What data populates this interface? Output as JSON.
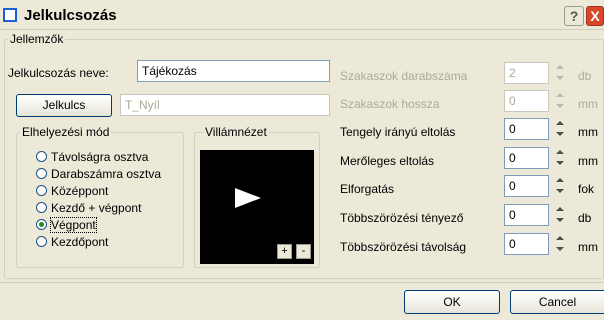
{
  "window": {
    "title": "Jelkulcsozás",
    "help_label": "?",
    "close_label": "X"
  },
  "jellemzok": {
    "label": "Jellemzők",
    "name_label": "Jelkulcsozás neve:",
    "name_value": "Tájékozás",
    "jelkulcs_button": "Jelkulcs",
    "jelkulcs_value": "T_Nyíl"
  },
  "placement": {
    "label": "Elhelyezési mód",
    "options": [
      "Távolságra osztva",
      "Darabszámra osztva",
      "Középpont",
      "Kezdő + végpont",
      "Végpont",
      "Kezdőpont"
    ],
    "selected": "Végpont"
  },
  "preview": {
    "label": "Villámnézet",
    "plus": "+",
    "minus": "-"
  },
  "params": [
    {
      "label": "Szakaszok darabszáma",
      "value": "2",
      "unit": "db",
      "enabled": false
    },
    {
      "label": "Szakaszok hossza",
      "value": "0",
      "unit": "mm",
      "enabled": false
    },
    {
      "label": "Tengely irányú eltolás",
      "value": "0",
      "unit": "mm",
      "enabled": true
    },
    {
      "label": "Merőleges eltolás",
      "value": "0",
      "unit": "mm",
      "enabled": true
    },
    {
      "label": "Elforgatás",
      "value": "0",
      "unit": "fok",
      "enabled": true
    },
    {
      "label": "Többszörözési tényező",
      "value": "0",
      "unit": "db",
      "enabled": true
    },
    {
      "label": "Többszörözési távolság",
      "value": "0",
      "unit": "mm",
      "enabled": true
    }
  ],
  "footer": {
    "ok": "OK",
    "cancel": "Cancel"
  }
}
